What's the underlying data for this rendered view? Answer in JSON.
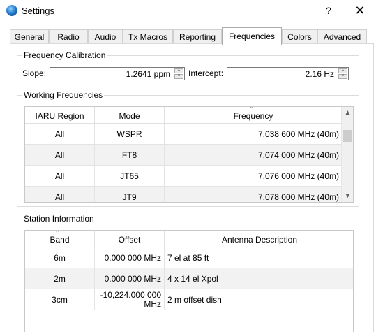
{
  "window": {
    "title": "Settings",
    "help": "?",
    "close": "✕"
  },
  "tabs": [
    {
      "label": "General"
    },
    {
      "label": "Radio"
    },
    {
      "label": "Audio"
    },
    {
      "label": "Tx Macros"
    },
    {
      "label": "Reporting"
    },
    {
      "label": "Frequencies"
    },
    {
      "label": "Colors"
    },
    {
      "label": "Advanced"
    }
  ],
  "active_tab": "Frequencies",
  "calibration": {
    "title": "Frequency Calibration",
    "slope_label": "Slope:",
    "slope_value": "1.2641 ppm",
    "intercept_label": "Intercept:",
    "intercept_value": "2.16 Hz"
  },
  "working": {
    "title": "Working Frequencies",
    "columns": [
      "IARU Region",
      "Mode",
      "Frequency"
    ],
    "sort_indicator": "^",
    "rows": [
      [
        "All",
        "WSPR",
        "7.038 600 MHz (40m)"
      ],
      [
        "All",
        "FT8",
        "7.074 000 MHz (40m)"
      ],
      [
        "All",
        "JT65",
        "7.076 000 MHz (40m)"
      ],
      [
        "All",
        "JT9",
        "7.078 000 MHz (40m)"
      ]
    ]
  },
  "station": {
    "title": "Station Information",
    "columns": [
      "Band",
      "Offset",
      "Antenna Description"
    ],
    "sort_indicator": "^",
    "rows": [
      [
        "6m",
        "0.000 000 MHz",
        "7 el at 85 ft"
      ],
      [
        "2m",
        "0.000 000 MHz",
        "4 x 14 el Xpol"
      ],
      [
        "3cm",
        "-10,224.000 000 MHz",
        "2 m offset dish"
      ]
    ],
    "offset_line1": "-10,224.000 000",
    "offset_line2": "MHz"
  },
  "icons": {
    "scroll_up": "chevron-up-icon",
    "scroll_down": "chevron-down-icon",
    "app": "globe-icon"
  }
}
